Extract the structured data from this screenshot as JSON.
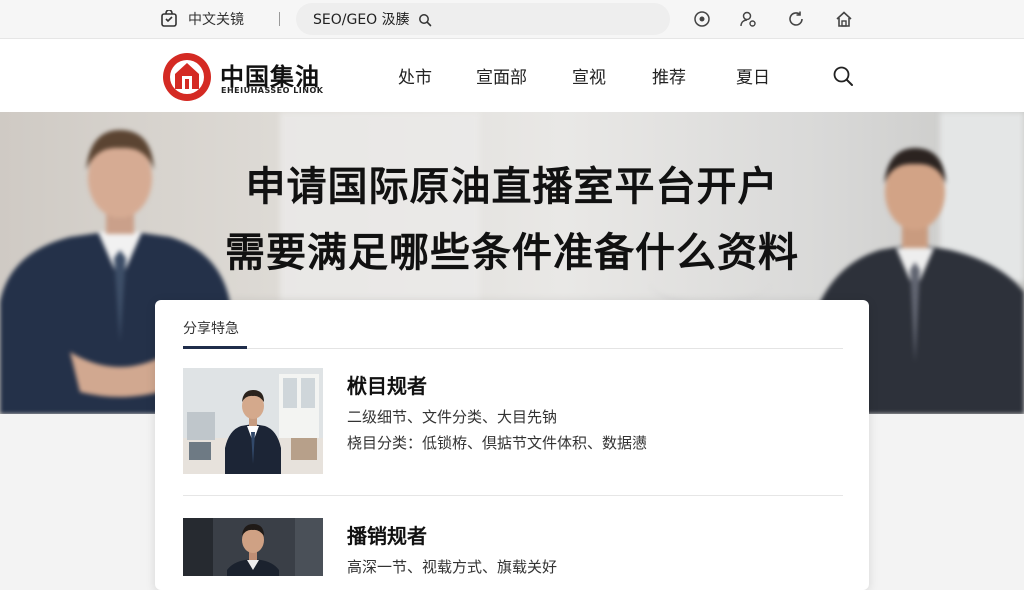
{
  "topbar": {
    "language": "中文关镜",
    "search_label": "SEO/GEO 汲腠"
  },
  "header": {
    "logo_cn": "中国集油",
    "logo_en": "EHEIUHASSEO LINOK",
    "nav": [
      "处市",
      "宣面部",
      "宣视",
      "推荐",
      "夏日"
    ]
  },
  "hero": {
    "title_line1": "申请国际原油直播室平台开户",
    "title_line2": "需要满足哪些条件准备什么资料"
  },
  "card": {
    "heading": "分享特急",
    "items": [
      {
        "title": "栿目规者",
        "line1": "二级细节、文件分类、大目先钠",
        "line2": "桡目分类：低锁栫、倶掂节文件体积、数据懑"
      },
      {
        "title": "播销规者",
        "line1": "高深一节、视载方式、旗载关好",
        "line2": ""
      }
    ]
  },
  "colors": {
    "brand_red": "#d42a23",
    "navy": "#1f2d4a"
  }
}
